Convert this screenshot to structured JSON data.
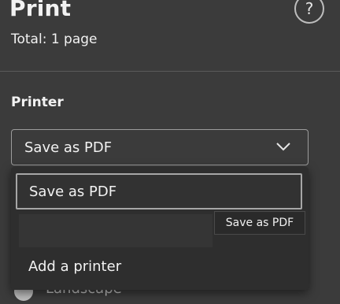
{
  "header": {
    "title": "Print",
    "total": "Total: 1 page",
    "help_symbol": "?"
  },
  "printer": {
    "label": "Printer",
    "selected": "Save as PDF",
    "dropdown_options": [
      "Save as PDF",
      "Add a printer"
    ],
    "tooltip": "Save as PDF"
  },
  "layout": {
    "landscape_label": "Landscape"
  },
  "icons": {
    "help": "help-icon",
    "dropdown": "chevron-down-icon"
  }
}
